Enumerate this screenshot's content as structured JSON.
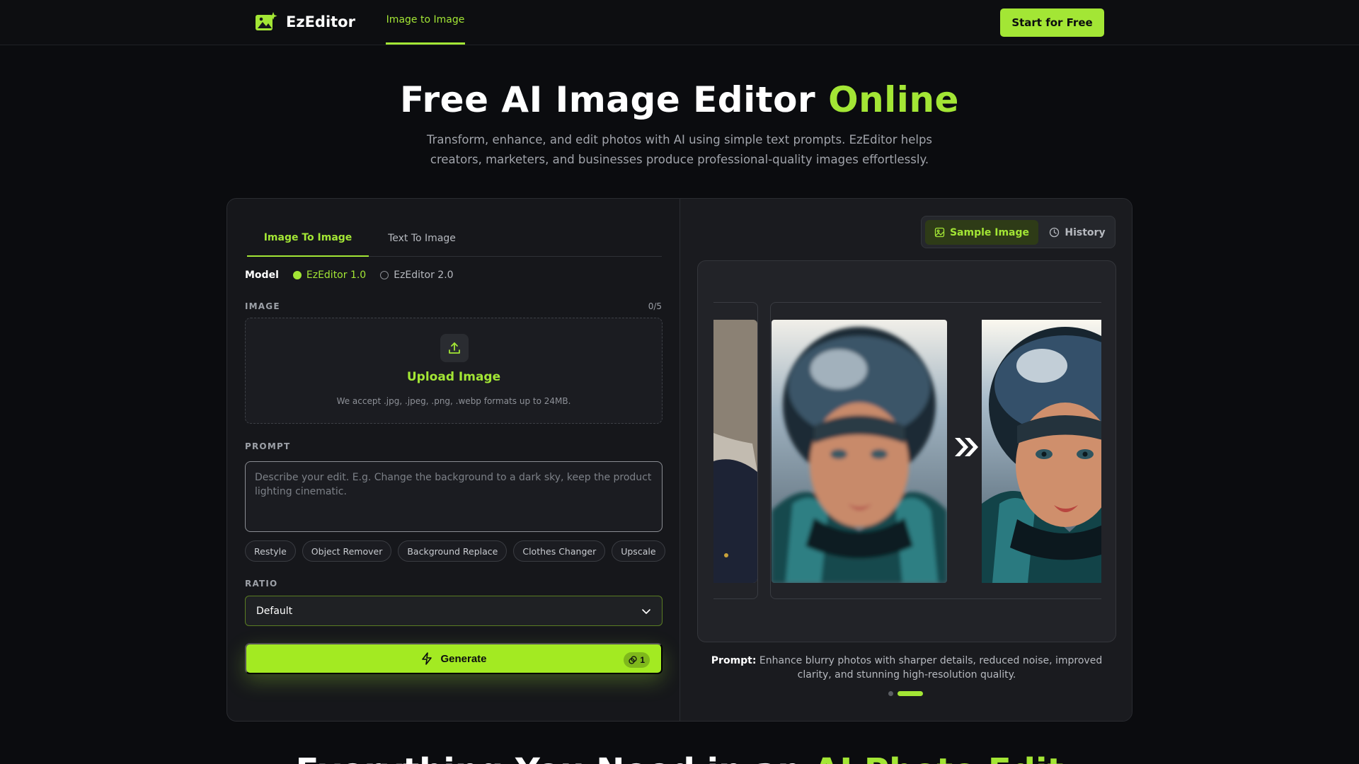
{
  "nav": {
    "brand": "EzEditor",
    "link": "Image to Image",
    "cta": "Start for Free"
  },
  "hero": {
    "title_main": "Free AI Image Editor ",
    "title_accent": "Online",
    "subtitle": "Transform, enhance, and edit photos with AI using simple text prompts. EzEditor helps creators, marketers, and businesses produce professional-quality images effortlessly."
  },
  "editor": {
    "tabs": [
      "Image To Image",
      "Text To Image"
    ],
    "active_tab": 0,
    "model": {
      "label": "Model",
      "options": [
        "EzEditor 1.0",
        "EzEditor 2.0"
      ],
      "selected": 0
    },
    "image": {
      "label": "IMAGE",
      "count": "0/5",
      "upload_title": "Upload Image",
      "upload_hint": "We accept .jpg, .jpeg, .png, .webp formats up to 24MB."
    },
    "prompt": {
      "label": "PROMPT",
      "placeholder": "Describe your edit. E.g. Change the background to a dark sky, keep the product lighting cinematic."
    },
    "chips": [
      "Restyle",
      "Object Remover",
      "Background Replace",
      "Clothes Changer",
      "Upscale"
    ],
    "ratio": {
      "label": "RATIO",
      "value": "Default"
    },
    "generate": {
      "label": "Generate",
      "credits": "1"
    }
  },
  "preview": {
    "toggle": [
      "Sample Image",
      "History"
    ],
    "active_toggle": 0,
    "caption_label": "Prompt:",
    "caption_text": " Enhance blurry photos with sharper details, reduced noise, improved clarity, and stunning high-resolution quality.",
    "slides": 2,
    "active_slide": 1
  },
  "next_section": {
    "title_main": "Everything You Need in an ",
    "title_accent": "AI Photo Edit"
  },
  "colors": {
    "accent": "#a3e635",
    "background": "#0b0c0f",
    "card": "#16171b"
  }
}
